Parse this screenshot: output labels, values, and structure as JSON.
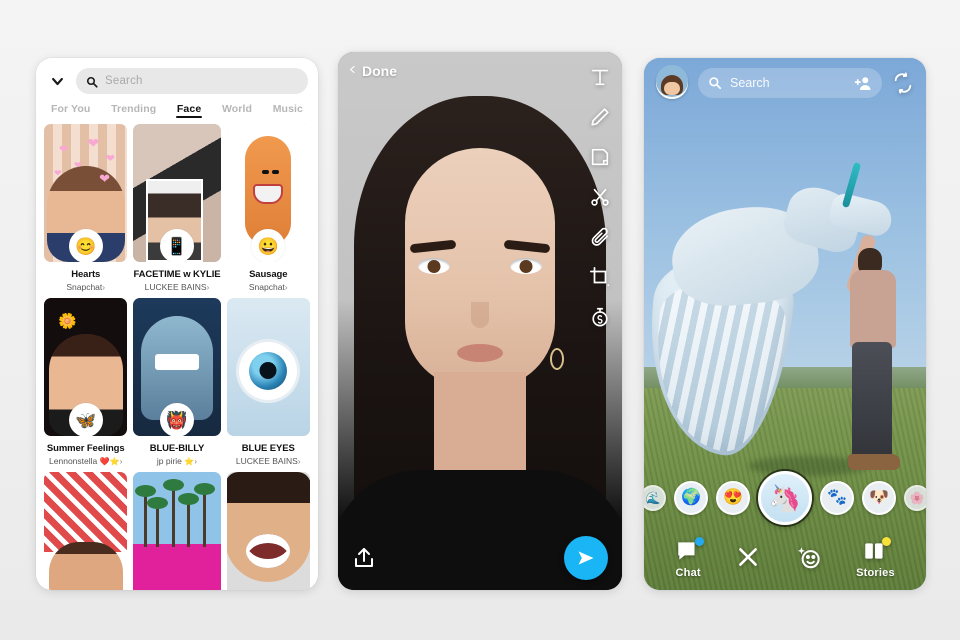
{
  "background_color": "#f0f0f0",
  "panels": {
    "discover": {
      "name": "Lens Explorer",
      "search": {
        "placeholder": "Search",
        "icon": "search-icon"
      },
      "collapse_icon": "chevron-down-icon",
      "tabs": [
        {
          "label": "For You",
          "active": false
        },
        {
          "label": "Trending",
          "active": false
        },
        {
          "label": "Face",
          "active": true
        },
        {
          "label": "World",
          "active": false
        },
        {
          "label": "Music",
          "active": false
        }
      ],
      "lenses": [
        {
          "title": "Hearts",
          "author": "Snapchat",
          "verified": false,
          "arrow": "›",
          "badge": "😊",
          "art": "art-hearts"
        },
        {
          "title": "FACETIME w KYLIE",
          "author": "LUCKEE BAINS",
          "verified": false,
          "arrow": "›",
          "badge": "📱",
          "art": "art-facetime"
        },
        {
          "title": "Sausage",
          "author": "Snapchat",
          "verified": false,
          "arrow": "›",
          "badge": "😀",
          "art": "art-sausage"
        },
        {
          "title": "Summer Feelings",
          "author": "Lennonstella",
          "verified": true,
          "heart": "❤️",
          "arrow": "›",
          "badge": "🦋",
          "art": "art-summer"
        },
        {
          "title": "BLUE-BILLY",
          "author": "jp pirie",
          "verified": true,
          "arrow": "›",
          "badge": "👹",
          "art": "art-billy"
        },
        {
          "title": "BLUE EYES",
          "author": "LUCKEE BAINS",
          "verified": false,
          "arrow": "›",
          "badge": "",
          "art": "art-eye"
        },
        {
          "title": "",
          "author": "",
          "arrow": "",
          "badge": "",
          "art": "art-bandana"
        },
        {
          "title": "",
          "author": "",
          "arrow": "",
          "badge": "",
          "art": "art-palms"
        },
        {
          "title": "",
          "author": "",
          "arrow": "",
          "badge": "",
          "art": "art-scream"
        }
      ],
      "verified_badge": "⭐"
    },
    "editor": {
      "name": "Snap Editor",
      "done_label": "Done",
      "back_icon": "chevron-left-icon",
      "tools": [
        {
          "name": "text-tool",
          "icon": "text-icon"
        },
        {
          "name": "draw-tool",
          "icon": "pencil-icon"
        },
        {
          "name": "sticker-tool",
          "icon": "sticker-icon"
        },
        {
          "name": "scissors-tool",
          "icon": "scissors-icon"
        },
        {
          "name": "attach-tool",
          "icon": "paperclip-icon"
        },
        {
          "name": "crop-tool",
          "icon": "crop-icon"
        },
        {
          "name": "timer-tool",
          "icon": "timer-icon"
        }
      ],
      "share_icon": "share-icon",
      "send_icon": "send-icon",
      "send_button_color": "#19B5F5"
    },
    "camera": {
      "name": "Camera with AR Lens",
      "search": {
        "placeholder": "Search",
        "icon": "search-icon"
      },
      "avatar_icon": "bitmoji-avatar",
      "add_friend_icon": "add-friend-icon",
      "flip_camera_icon": "flip-camera-icon",
      "carousel": [
        {
          "name": "lens-scroll-left",
          "glyph": "🌊",
          "size": "edge",
          "selected": false
        },
        {
          "name": "lens-marble",
          "glyph": "🌍",
          "size": "normal",
          "selected": false
        },
        {
          "name": "lens-faces",
          "glyph": "😍",
          "size": "normal",
          "selected": false
        },
        {
          "name": "lens-unicorn",
          "glyph": "🦄",
          "size": "selected",
          "selected": true
        },
        {
          "name": "lens-dots",
          "glyph": "🐾",
          "size": "normal",
          "selected": false
        },
        {
          "name": "lens-paws",
          "glyph": "🐶",
          "size": "normal",
          "selected": false
        },
        {
          "name": "lens-scroll-right",
          "glyph": "🌸",
          "size": "edge",
          "selected": false
        }
      ],
      "nav": [
        {
          "name": "chat",
          "label": "Chat",
          "icon": "chat-bubble-icon",
          "badge_color": "#23A9F2"
        },
        {
          "name": "close",
          "label": "",
          "icon": "close-icon",
          "badge_color": ""
        },
        {
          "name": "lenses",
          "label": "",
          "icon": "lens-smiley-icon",
          "badge_color": ""
        },
        {
          "name": "stories",
          "label": "Stories",
          "icon": "stories-icon",
          "badge_color": "#F7E13A"
        }
      ]
    }
  }
}
